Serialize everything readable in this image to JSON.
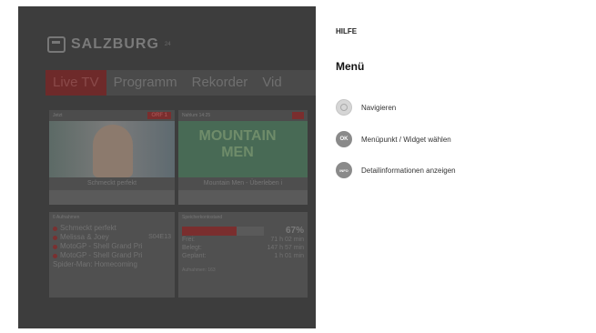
{
  "brand": {
    "name": "SALZBURG",
    "sup": "24"
  },
  "nav": {
    "tabs": [
      "Live TV",
      "Programm",
      "Rekorder",
      "Vid"
    ]
  },
  "cards": [
    {
      "head": "Jetzt",
      "badge": "ORF 1",
      "caption": "Schmeckt perfekt"
    },
    {
      "head": "Nahlum 14:25",
      "badge": "",
      "title": "MOUNTAIN MEN",
      "caption": "Mountain Men - Überleben i"
    }
  ],
  "upcoming": {
    "head": "6 Aufnahmen",
    "items": [
      {
        "label": "Schmeckt perfekt",
        "extra": ""
      },
      {
        "label": "Melissa & Joey",
        "extra": "S04E13"
      },
      {
        "label": "MotoGP - Shell Grand Pri",
        "extra": ""
      },
      {
        "label": "MotoGP - Shell Grand Pri",
        "extra": ""
      },
      {
        "label": "Spider-Man: Homecoming",
        "extra": ""
      }
    ]
  },
  "stats": {
    "head": "Speicherkontostand",
    "progress": 0.67,
    "percent": "67%",
    "rows": [
      {
        "label": "Frei:",
        "value": "71 h 02 min"
      },
      {
        "label": "Belegt:",
        "value": "147 h 57 min"
      },
      {
        "label": "Geplant:",
        "value": "1 h 01 min"
      }
    ],
    "foot": "Aufnahmen: 163"
  },
  "help": {
    "kicker": "HILFE",
    "title": "Menü",
    "items": [
      {
        "key": "",
        "icon": "nav-ring-icon",
        "label": "Navigieren"
      },
      {
        "key": "OK",
        "icon": "ok-key-icon",
        "label": "Menüpunkt / Widget wählen"
      },
      {
        "key": "INFO",
        "icon": "info-key-icon",
        "label": "Detailinformationen anzeigen"
      }
    ]
  }
}
